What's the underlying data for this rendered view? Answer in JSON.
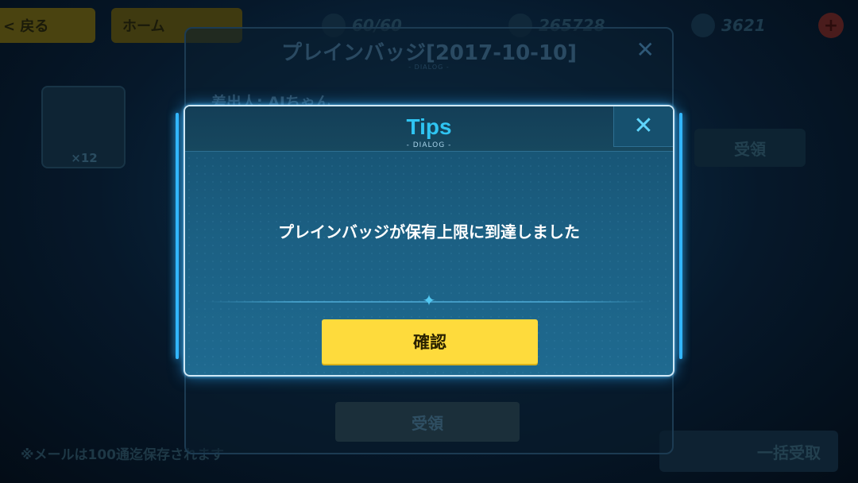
{
  "topbar": {
    "back_label": "< 戻る",
    "home_label": "ホーム",
    "stamina": "60/60",
    "coins": "265728",
    "gems": "3621",
    "plus": "+"
  },
  "background": {
    "mail_item_count": "×12",
    "receive_label": "受領",
    "footnote": "※メールは100通迄保存されます",
    "bulk_receive_label": "一括受取"
  },
  "bg_dialog": {
    "title": "プレインバッジ[2017-10-10]",
    "subtitle": "- DIALOG -",
    "close": "✕",
    "sender": "差出人: AIちゃん",
    "receive_label": "受領"
  },
  "tips_dialog": {
    "title": "Tips",
    "subtitle": "- DIALOG -",
    "close": "✕",
    "message": "プレインバッジが保有上限に到達しました",
    "confirm_label": "確認",
    "divider_icon": "✦"
  },
  "colors": {
    "accent": "#2fc4f2",
    "confirm_button": "#fedb3c"
  }
}
